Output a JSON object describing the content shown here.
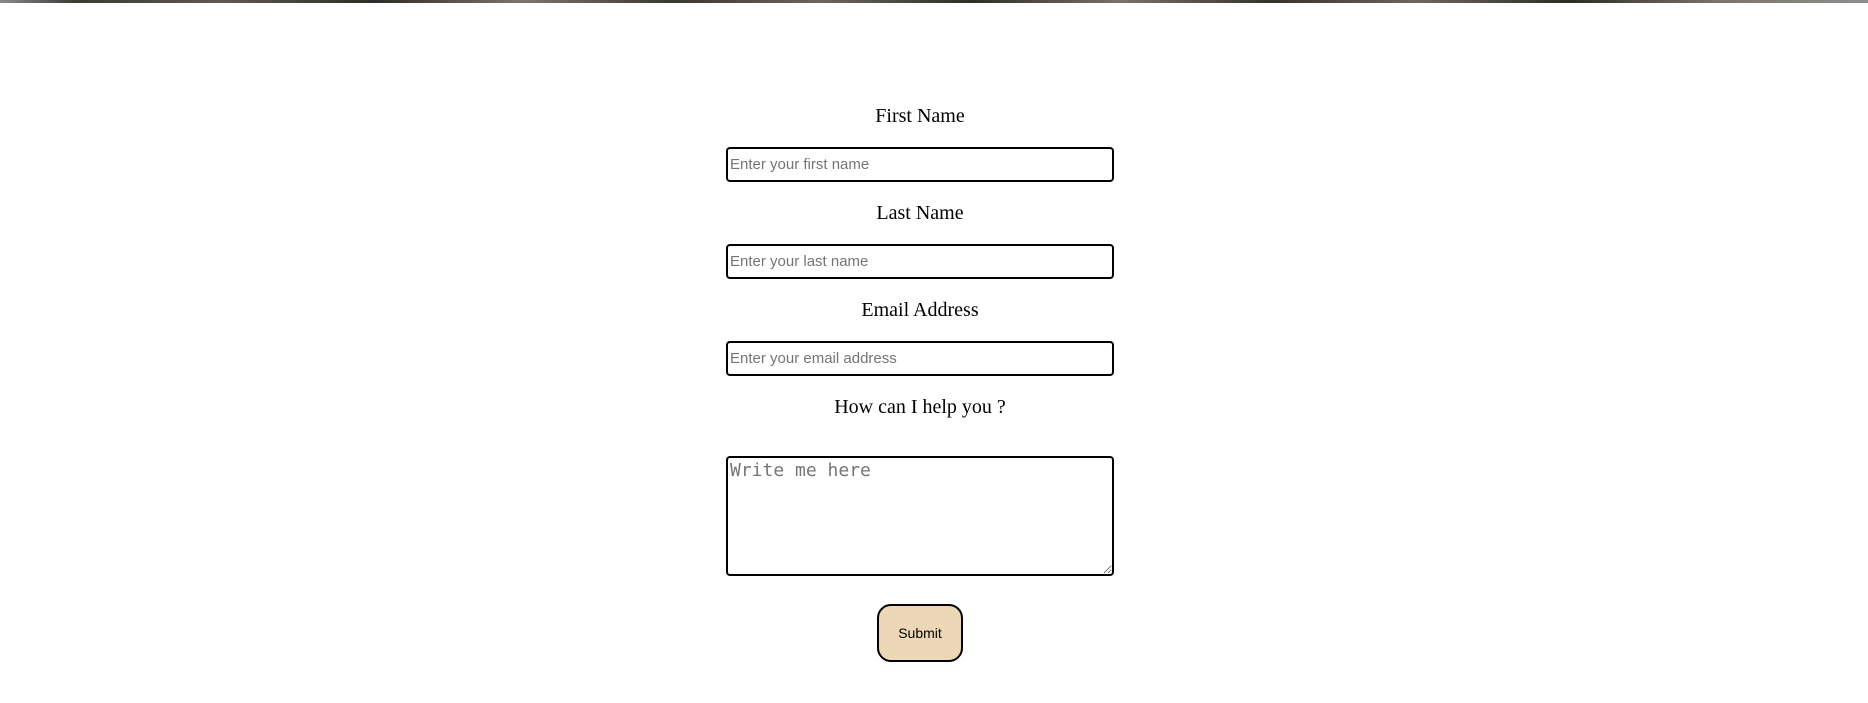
{
  "form": {
    "first_name": {
      "label": "First Name",
      "placeholder": "Enter your first name",
      "value": ""
    },
    "last_name": {
      "label": "Last Name",
      "placeholder": "Enter your last name",
      "value": ""
    },
    "email": {
      "label": "Email Address",
      "placeholder": "Enter your email address",
      "value": ""
    },
    "message": {
      "label": "How can I help you ?",
      "placeholder": "Write me here",
      "value": ""
    },
    "submit_label": "Submit"
  },
  "colors": {
    "submit_background": "#ecd8b7",
    "border": "#000000",
    "placeholder": "#757575"
  }
}
